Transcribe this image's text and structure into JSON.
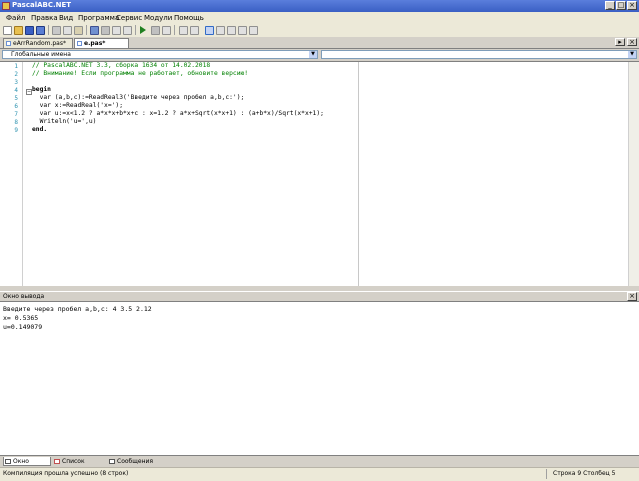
{
  "window": {
    "title": "PascalABC.NET"
  },
  "menu": [
    "Файл",
    "Правка",
    "Вид",
    "Программа",
    "Сервис",
    "Модули",
    "Помощь"
  ],
  "tabs": [
    {
      "label": "eArrRandom.pas*",
      "active": false
    },
    {
      "label": "e.pas*",
      "active": true
    }
  ],
  "combos": {
    "left_value": "Глобальные имена",
    "right_value": ""
  },
  "editor": {
    "line_numbers": [
      "1",
      "2",
      "3",
      "4",
      "5",
      "6",
      "7",
      "8",
      "9"
    ],
    "lines": [
      "// PascalABC.NET 3.3, сборка 1634 от 14.02.2018",
      "// Внимание! Если программа не работает, обновите версию!",
      "",
      "begin",
      "  var (a,b,c):=ReadReal3('Введите через пробел a,b,c:');",
      "  var x:=ReadReal('x=');",
      "  var u:=x<1.2 ? a*x*x+b*x+c : x=1.2 ? a*x+Sqrt(x*x+1) : (a+b*x)/Sqrt(x*x+1);",
      "  Writeln('u=',u)",
      "end."
    ]
  },
  "output": {
    "title": "Окно вывода",
    "lines": [
      "Введите через пробел a,b,c: 4 3.5 2.12",
      "x= 0.5365",
      "u=0.149079"
    ]
  },
  "bottom_tabs": [
    "Окно вывода",
    "Список ошибок",
    "Сообщения компилятора"
  ],
  "status": {
    "message": "Компиляция прошла успешно (8 строк)",
    "position": "Строка 9 Столбец 5"
  }
}
